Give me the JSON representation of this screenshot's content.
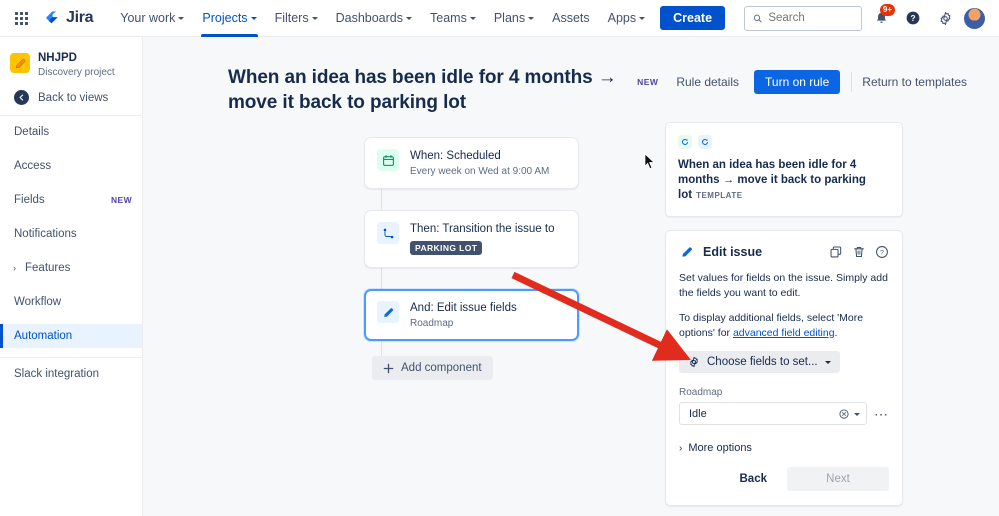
{
  "topnav": {
    "app_switcher_icon": "grid-apps-icon",
    "brand": "Jira",
    "items": [
      {
        "label": "Your work",
        "has_caret": true,
        "active": false
      },
      {
        "label": "Projects",
        "has_caret": true,
        "active": true
      },
      {
        "label": "Filters",
        "has_caret": true,
        "active": false
      },
      {
        "label": "Dashboards",
        "has_caret": true,
        "active": false
      },
      {
        "label": "Teams",
        "has_caret": true,
        "active": false
      },
      {
        "label": "Plans",
        "has_caret": true,
        "active": false
      },
      {
        "label": "Assets",
        "has_caret": false,
        "active": false
      },
      {
        "label": "Apps",
        "has_caret": true,
        "active": false
      }
    ],
    "create_label": "Create",
    "search": {
      "placeholder": "Search",
      "value": ""
    },
    "notifications_badge": "9+",
    "help_icon": "help-circle-icon",
    "settings_icon": "gear-icon",
    "avatar_icon": "user-avatar"
  },
  "sidebar": {
    "project_key": "NHJPD",
    "project_type": "Discovery project",
    "back_label": "Back to views",
    "items": [
      {
        "label": "Details",
        "badge": "",
        "selected": false,
        "chevron": false
      },
      {
        "label": "Access",
        "badge": "",
        "selected": false,
        "chevron": false
      },
      {
        "label": "Fields",
        "badge": "NEW",
        "selected": false,
        "chevron": false
      },
      {
        "label": "Notifications",
        "badge": "",
        "selected": false,
        "chevron": false
      },
      {
        "label": "Features",
        "badge": "",
        "selected": false,
        "chevron": true
      },
      {
        "label": "Workflow",
        "badge": "",
        "selected": false,
        "chevron": false
      },
      {
        "label": "Automation",
        "badge": "",
        "selected": true,
        "chevron": false
      }
    ],
    "footer_items": [
      {
        "label": "Slack integration"
      }
    ]
  },
  "header": {
    "title": "When an idea has been idle for 4 months → move it back to parking lot",
    "new_tag": "NEW",
    "rule_details_label": "Rule details",
    "turn_on_label": "Turn on rule",
    "return_label": "Return to templates"
  },
  "chain": {
    "cards": [
      {
        "icon": "calendar-icon",
        "title": "When: Scheduled",
        "sub": "Every week on Wed at 9:00 AM",
        "lozenge": "",
        "selected": false
      },
      {
        "icon": "transition-branch-icon",
        "title": "Then: Transition the issue to",
        "sub": "",
        "lozenge": "PARKING LOT",
        "selected": false
      },
      {
        "icon": "pencil-edit-icon",
        "title": "And: Edit issue fields",
        "sub": "Roadmap",
        "lozenge": "",
        "selected": true
      }
    ],
    "add_component_label": "Add component"
  },
  "right_panel": {
    "template_card": {
      "title": "When an idea has been idle for 4 months → move it back to parking lot",
      "badge": "TEMPLATE",
      "icons": [
        "refresh-icon",
        "refresh-icon"
      ]
    },
    "edit_issue": {
      "icon": "pencil-edit-icon",
      "title": "Edit issue",
      "actions": [
        "copy-icon",
        "trash-icon",
        "help-circle-icon"
      ],
      "description": "Set values for fields on the issue. Simply add the fields you want to edit.",
      "description2_prefix": "To display additional fields, select 'More options' for ",
      "description2_link": "advanced field editing",
      "description2_suffix": ".",
      "choose_fields_label": "Choose fields to set...",
      "choose_fields_icon": "gear-icon",
      "field_label": "Roadmap",
      "field_value": "Idle",
      "field_clear_icon": "clear-circle-icon",
      "field_chevron_icon": "chevron-down-icon",
      "field_more_icon": "ellipsis-icon",
      "more_options_label": "More options",
      "back_label": "Back",
      "next_label": "Next"
    }
  },
  "colors": {
    "brand_blue": "#0052cc",
    "primary_btn": "#0c66e4",
    "selected_border": "#4c9aff",
    "annotation_red": "#e12b1f",
    "new_tag_purple": "#5243aa",
    "canvas_bg": "#f7f8f9"
  },
  "annotation": {
    "arrow": "red-arrow-pointing-to-roadmap-field"
  }
}
